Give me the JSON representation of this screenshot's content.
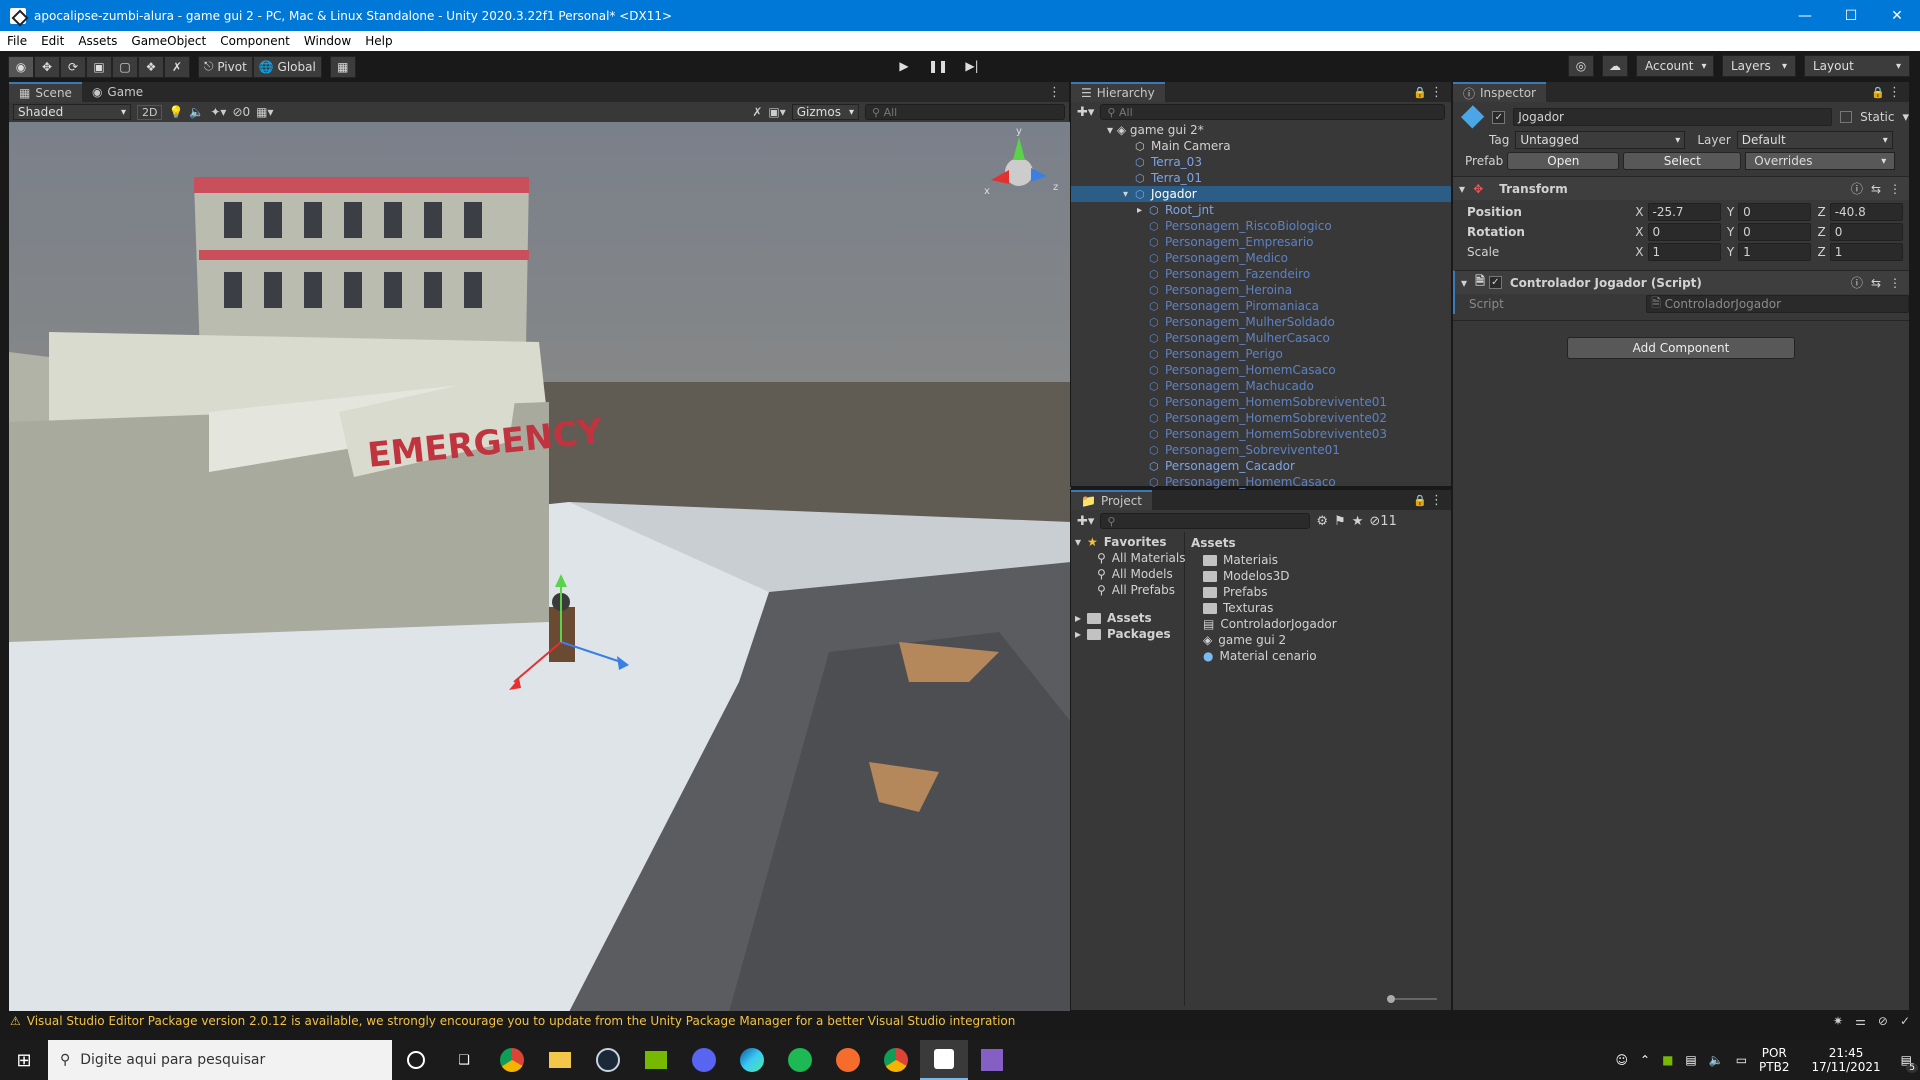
{
  "window": {
    "title": "apocalipse-zumbi-alura - game gui 2 - PC, Mac & Linux Standalone - Unity 2020.3.22f1 Personal* <DX11>"
  },
  "menu": [
    "File",
    "Edit",
    "Assets",
    "GameObject",
    "Component",
    "Window",
    "Help"
  ],
  "toolbar": {
    "pivot": "Pivot",
    "global": "Global",
    "account": "Account",
    "layers": "Layers",
    "layout": "Layout"
  },
  "scene": {
    "tabs": [
      "Scene",
      "Game"
    ],
    "shading": "Shaded",
    "mode2d": "2D",
    "hidden_count": "0",
    "gizmos": "Gizmos",
    "search_placeholder": "All",
    "sign": "EMERGENCY",
    "axis_x": "x",
    "axis_y": "y",
    "axis_z": "z"
  },
  "hierarchy": {
    "title": "Hierarchy",
    "search_placeholder": "All",
    "scene_name": "game gui 2*",
    "items": [
      {
        "label": "Main Camera",
        "indent": 1,
        "type": "obj"
      },
      {
        "label": "Terra_03",
        "indent": 1,
        "type": "pref"
      },
      {
        "label": "Terra_01",
        "indent": 1,
        "type": "pref"
      },
      {
        "label": "Jogador",
        "indent": 1,
        "type": "sel"
      },
      {
        "label": "Root_jnt",
        "indent": 2,
        "type": "pref"
      },
      {
        "label": "Personagem_RiscoBiologico",
        "indent": 2,
        "type": "dim"
      },
      {
        "label": "Personagem_Empresario",
        "indent": 2,
        "type": "dim"
      },
      {
        "label": "Personagem_Medico",
        "indent": 2,
        "type": "dim"
      },
      {
        "label": "Personagem_Fazendeiro",
        "indent": 2,
        "type": "dim"
      },
      {
        "label": "Personagem_Heroina",
        "indent": 2,
        "type": "dim"
      },
      {
        "label": "Personagem_Piromaniaca",
        "indent": 2,
        "type": "dim"
      },
      {
        "label": "Personagem_MulherSoldado",
        "indent": 2,
        "type": "dim"
      },
      {
        "label": "Personagem_MulherCasaco",
        "indent": 2,
        "type": "dim"
      },
      {
        "label": "Personagem_Perigo",
        "indent": 2,
        "type": "dim"
      },
      {
        "label": "Personagem_HomemCasaco",
        "indent": 2,
        "type": "dim"
      },
      {
        "label": "Personagem_Machucado",
        "indent": 2,
        "type": "dim"
      },
      {
        "label": "Personagem_HomemSobrevivente01",
        "indent": 2,
        "type": "dim"
      },
      {
        "label": "Personagem_HomemSobrevivente02",
        "indent": 2,
        "type": "dim"
      },
      {
        "label": "Personagem_HomemSobrevivente03",
        "indent": 2,
        "type": "dim"
      },
      {
        "label": "Personagem_Sobrevivente01",
        "indent": 2,
        "type": "dim"
      },
      {
        "label": "Personagem_Cacador",
        "indent": 2,
        "type": "pref"
      },
      {
        "label": "Personagem_HomemCasaco",
        "indent": 2,
        "type": "dim"
      }
    ]
  },
  "project": {
    "title": "Project",
    "count": "11",
    "favorites_label": "Favorites",
    "favorites": [
      "All Materials",
      "All Models",
      "All Prefabs"
    ],
    "roots": [
      "Assets",
      "Packages"
    ],
    "breadcrumb": "Assets",
    "assets": [
      {
        "label": "Materiais",
        "kind": "folder"
      },
      {
        "label": "Modelos3D",
        "kind": "folder"
      },
      {
        "label": "Prefabs",
        "kind": "folder"
      },
      {
        "label": "Texturas",
        "kind": "folder"
      },
      {
        "label": "ControladorJogador",
        "kind": "script"
      },
      {
        "label": "game gui 2",
        "kind": "scene"
      },
      {
        "label": "Material cenario",
        "kind": "material"
      }
    ]
  },
  "inspector": {
    "title": "Inspector",
    "object_name": "Jogador",
    "static_label": "Static",
    "tag_label": "Tag",
    "tag_value": "Untagged",
    "layer_label": "Layer",
    "layer_value": "Default",
    "prefab_label": "Prefab",
    "open": "Open",
    "select": "Select",
    "overrides": "Overrides",
    "transform": {
      "title": "Transform",
      "position": {
        "label": "Position",
        "x": "-25.7",
        "y": "0",
        "z": "-40.8"
      },
      "rotation": {
        "label": "Rotation",
        "x": "0",
        "y": "0",
        "z": "0"
      },
      "scale": {
        "label": "Scale",
        "x": "1",
        "y": "1",
        "z": "1"
      }
    },
    "script_comp": {
      "title": "Controlador Jogador (Script)",
      "script_label": "Script",
      "script_value": "ControladorJogador"
    },
    "add_component": "Add Component"
  },
  "status": {
    "message": "Visual Studio Editor Package version 2.0.12 is available, we strongly encourage you to update from the Unity Package Manager for a better Visual Studio integration"
  },
  "taskbar": {
    "search_placeholder": "Digite aqui para pesquisar",
    "lang1": "POR",
    "lang2": "PTB2",
    "time": "21:45",
    "date": "17/11/2021",
    "notif_count": "5"
  }
}
